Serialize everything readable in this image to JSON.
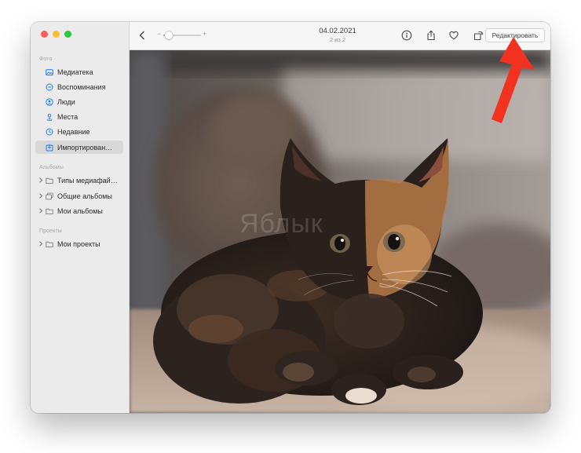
{
  "sidebar": {
    "sections": [
      {
        "header": "Фото",
        "items": [
          {
            "label": "Медиатека",
            "icon": "photo-library-icon",
            "selected": false
          },
          {
            "label": "Воспоминания",
            "icon": "memories-icon",
            "selected": false
          },
          {
            "label": "Люди",
            "icon": "people-icon",
            "selected": false
          },
          {
            "label": "Места",
            "icon": "places-icon",
            "selected": false
          },
          {
            "label": "Недавние",
            "icon": "recents-icon",
            "selected": false
          },
          {
            "label": "Импортирован…",
            "icon": "import-icon",
            "selected": true
          }
        ]
      },
      {
        "header": "Альбомы",
        "items": [
          {
            "label": "Типы медиафай…",
            "icon": "folder-icon"
          },
          {
            "label": "Общие альбомы",
            "icon": "shared-albums-icon"
          },
          {
            "label": "Мои альбомы",
            "icon": "folder-icon"
          }
        ]
      },
      {
        "header": "Проекты",
        "items": [
          {
            "label": "Мои проекты",
            "icon": "folder-icon"
          }
        ]
      }
    ]
  },
  "toolbar": {
    "date": "04.02.2021",
    "count": "2 из 2",
    "zoom_minus": "−",
    "zoom_plus": "+",
    "zoom_level": 0.15,
    "edit_label": "Редактировать"
  },
  "photo": {
    "watermark": "Яблык"
  },
  "colors": {
    "accent_icon": "#1a7cf5",
    "annotation_arrow": "#f0321e"
  }
}
